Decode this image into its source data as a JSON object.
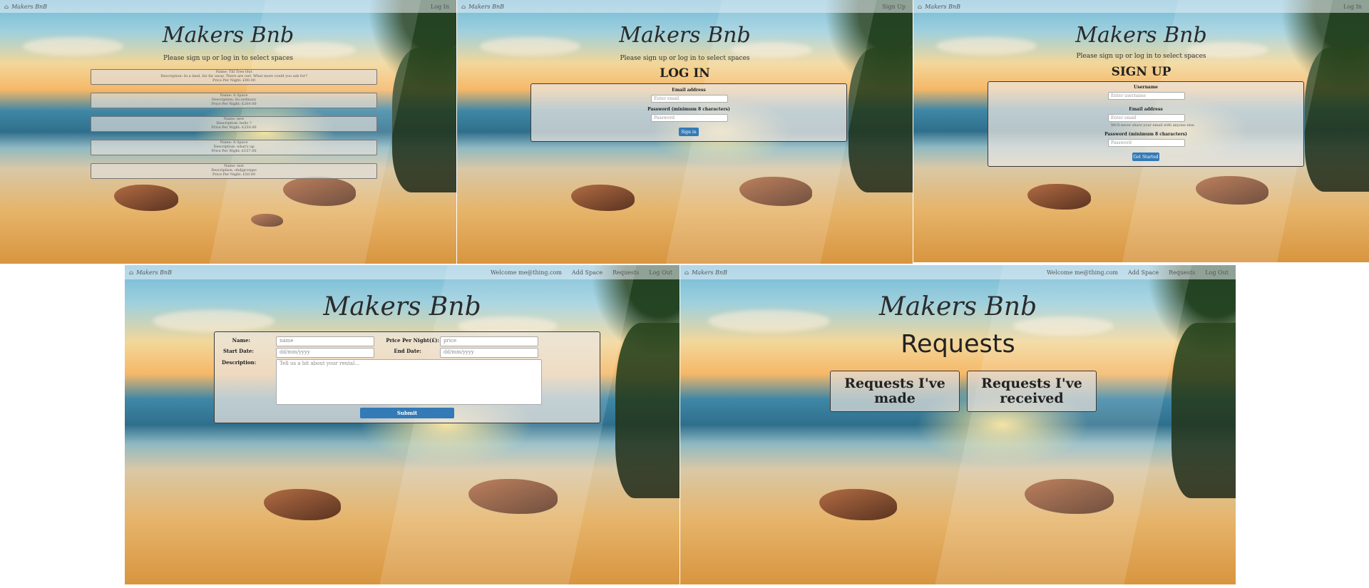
{
  "brand": "Makers BnB",
  "site_title": "Makers Bnb",
  "home_icon": "home-icon",
  "subtitle": "Please sign up or log in to select spaces",
  "colors": {
    "accent": "#337ab7",
    "overlay": "#e6e1dc",
    "border": "#3a3a3a"
  },
  "panel1": {
    "nav_right": "Log In",
    "listings": [
      {
        "name": "Name: Till Tree Hut",
        "description": "Description: In a land, far far away. There are owl. What more could you ask for?",
        "price": "Price Per Night: £90.00"
      },
      {
        "name": "Name: A Space",
        "description": "Description: So ordinary",
        "price": "Price Per Night: £200.00"
      },
      {
        "name": "Name: new",
        "description": "Description: hello ?",
        "price": "Price Per Night: £250.00"
      },
      {
        "name": "Name: A Space",
        "description": "Description: what's up",
        "price": "Price Per Night: £157.00"
      },
      {
        "name": "Name: test",
        "description": "Description: ohdjgrorpps",
        "price": "Price Per Night: £50.00"
      }
    ]
  },
  "panel2": {
    "nav_right": "Sign Up",
    "heading": "LOG IN",
    "email_label": "Email address",
    "email_placeholder": "Enter email",
    "password_label": "Password (minimum 8 characters)",
    "password_placeholder": "Password",
    "submit": "Sign in"
  },
  "panel3": {
    "nav_right": "Log In",
    "heading": "SIGN UP",
    "username_label": "Username",
    "username_placeholder": "Enter username",
    "email_label": "Email address",
    "email_placeholder": "Enter email",
    "email_hint": "We'll never share your email with anyone else.",
    "password_label": "Password (minimum 8 characters)",
    "password_placeholder": "Password",
    "submit": "Get Started"
  },
  "panel4": {
    "nav": {
      "welcome": "Welcome me@thing.com",
      "add_space": "Add Space",
      "requests": "Requests",
      "logout": "Log Out"
    },
    "name_label": "Name:",
    "name_placeholder": "name",
    "price_label": "Price Per Night(£):",
    "price_placeholder": "price",
    "start_label": "Start Date:",
    "start_placeholder": "dd/mm/yyyy",
    "end_label": "End Date:",
    "end_placeholder": "dd/mm/yyyy",
    "description_label": "Description:",
    "description_placeholder": "Tell us a bit about your rental...",
    "submit": "Submit"
  },
  "panel5": {
    "nav": {
      "welcome": "Welcome me@thing.com",
      "add_space": "Add Space",
      "requests": "Requests",
      "logout": "Log Out"
    },
    "heading": "Requests",
    "made": "Requests I've made",
    "received": "Requests I've received"
  }
}
